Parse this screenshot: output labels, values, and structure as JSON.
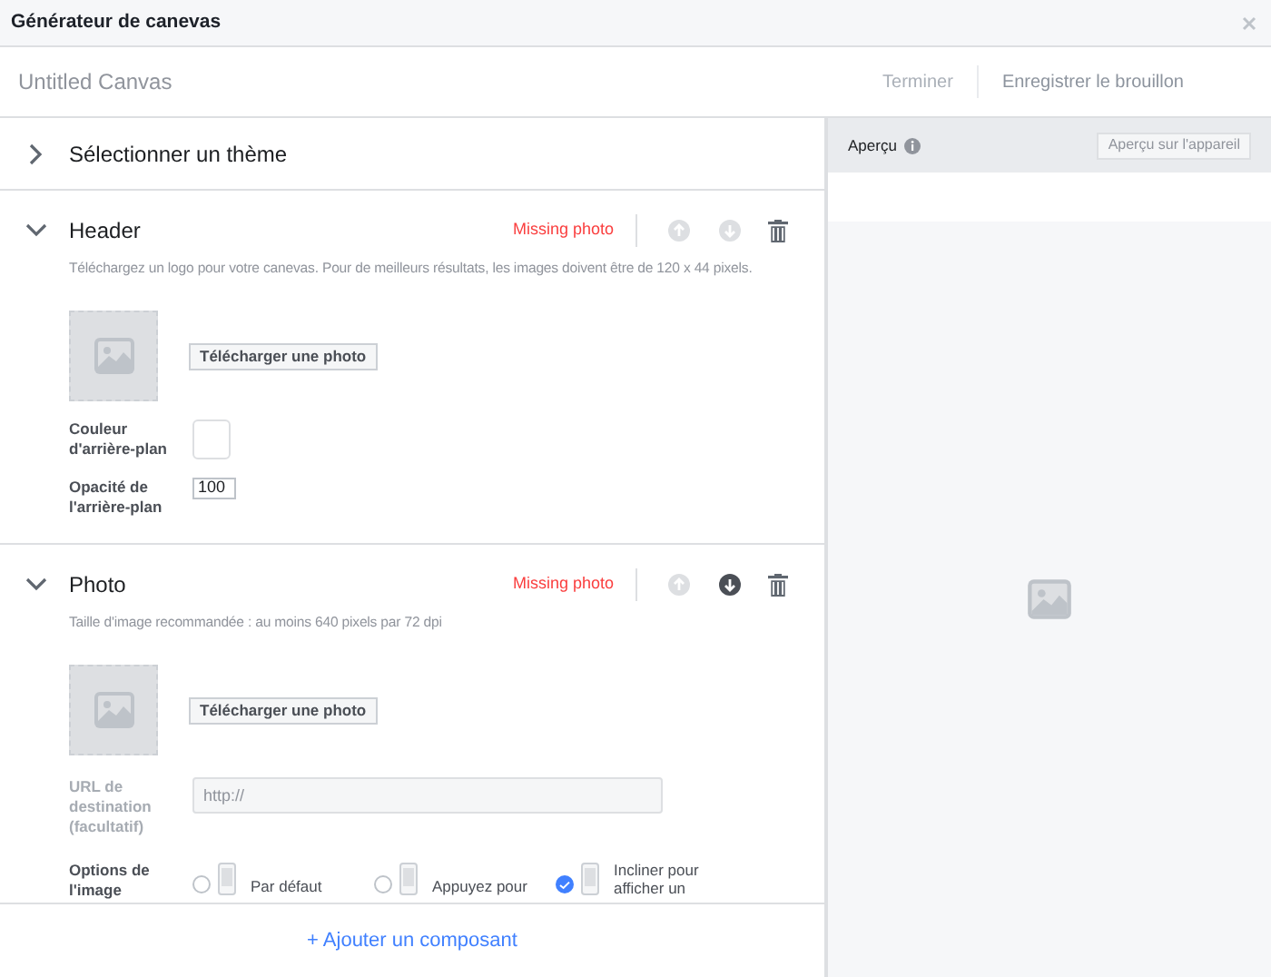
{
  "window": {
    "title": "Générateur de canevas"
  },
  "toolbar": {
    "canvas_name": "Untitled Canvas",
    "actions": [
      {
        "label": "Terminer",
        "disabled": true
      },
      {
        "label": "Enregistrer le brouillon",
        "disabled": false
      }
    ]
  },
  "theme": {
    "label": "Sélectionner un thème",
    "expanded": false
  },
  "components": [
    {
      "title": "Header",
      "expanded": true,
      "status": "Missing photo",
      "move_up_disabled": true,
      "move_down_disabled": true,
      "hint": "Téléchargez un logo pour votre canevas. Pour de meilleurs résultats, les images doivent être de 120 x 44 pixels.",
      "upload_button": "Télécharger une photo",
      "fields": [
        {
          "kind": "color",
          "label": "Couleur d'arrière-plan"
        },
        {
          "kind": "number",
          "label": "Opacité de l'arrière-plan",
          "value": "100"
        }
      ]
    },
    {
      "title": "Photo",
      "expanded": true,
      "status": "Missing photo",
      "move_up_disabled": true,
      "move_down_disabled": false,
      "hint": "Taille d'image recommandée : au moins 640 pixels par 72 dpi",
      "upload_button": "Télécharger une photo",
      "fields": [
        {
          "kind": "url",
          "label": "URL de destination (facultatif)",
          "placeholder": "http://",
          "disabled": true
        },
        {
          "kind": "options",
          "label": "Options de l'image",
          "options": [
            {
              "label": "Par défaut",
              "selected": false
            },
            {
              "label": "Appuyez pour",
              "selected": false
            },
            {
              "label": "Incliner pour afficher un",
              "selected": true
            }
          ]
        }
      ]
    }
  ],
  "add_button": "+ Ajouter un composant",
  "preview": {
    "label": "Aperçu",
    "device_button": "Aperçu sur l'appareil"
  }
}
